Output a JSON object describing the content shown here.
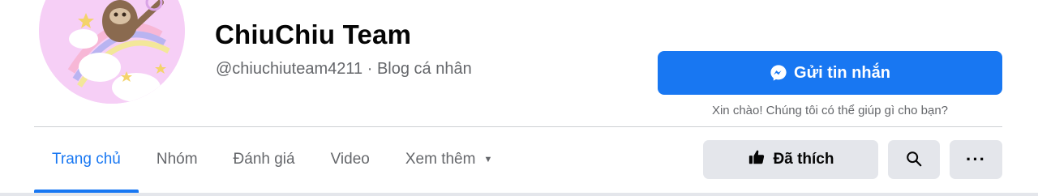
{
  "page": {
    "name": "ChiuChiu Team",
    "handle": "@chiuchiuteam4211",
    "separator": " · ",
    "category": "Blog cá nhân"
  },
  "actions": {
    "message_label": "Gửi tin nhắn",
    "greeting": "Xin chào! Chúng tôi có thể giúp gì cho bạn?",
    "liked_label": "Đã thích",
    "more_label": "···"
  },
  "tabs": [
    {
      "label": "Trang chủ",
      "active": true
    },
    {
      "label": "Nhóm",
      "active": false
    },
    {
      "label": "Đánh giá",
      "active": false
    },
    {
      "label": "Video",
      "active": false
    },
    {
      "label": "Xem thêm",
      "active": false
    }
  ],
  "icons": {
    "message": "messenger-icon",
    "liked": "thumbs-up-icon",
    "search": "search-icon",
    "more": "more-dots-icon",
    "dropdown": "caret-down-icon"
  },
  "colors": {
    "accent": "#1877f2",
    "secondary_text": "#65676b",
    "button_gray": "#e4e6eb",
    "avatar_bg": "#f6cff6"
  }
}
